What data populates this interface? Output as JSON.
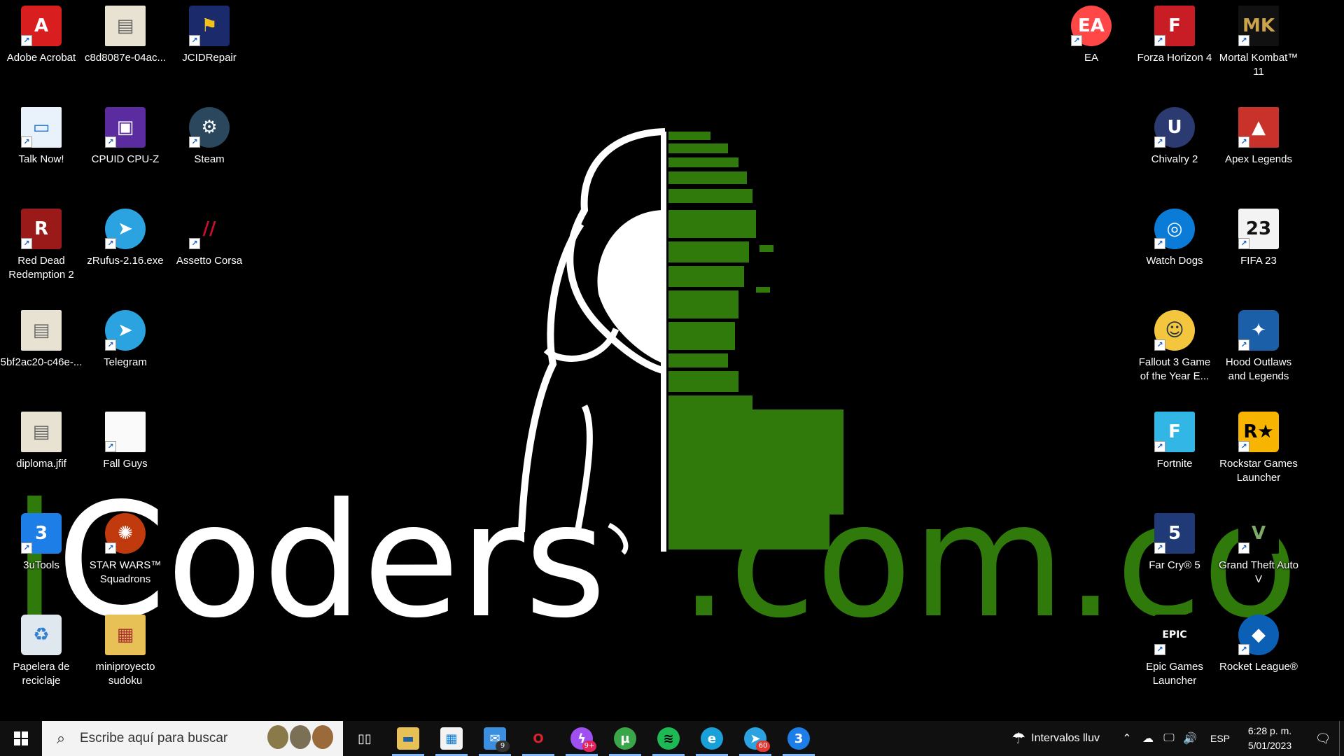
{
  "wallpaper": {
    "brand_lead": "i",
    "brand_rest": "Coders",
    "domain": ".com.co"
  },
  "desktop_icons": [
    {
      "id": "adobe-acrobat",
      "label": "Adobe Acrobat",
      "icon": "acrobat-icon"
    },
    {
      "id": "c8d8087e",
      "label": "c8d8087e-04ac...",
      "icon": "image-file-icon"
    },
    {
      "id": "jcidrepair",
      "label": "JCIDRepair",
      "icon": "jcid-icon"
    },
    {
      "id": "talk-now",
      "label": "Talk Now!",
      "icon": "window-icon"
    },
    {
      "id": "cpuz",
      "label": "CPUID CPU-Z",
      "icon": "cpu-icon"
    },
    {
      "id": "steam",
      "label": "Steam",
      "icon": "steam-icon"
    },
    {
      "id": "rdr2",
      "label": "Red Dead Redemption 2",
      "icon": "rdr2-icon"
    },
    {
      "id": "zrufus",
      "label": "zRufus-2.16.exe",
      "icon": "telegram-icon"
    },
    {
      "id": "assetto",
      "label": "Assetto Corsa",
      "icon": "assetto-icon"
    },
    {
      "id": "5bf2ac20",
      "label": "5bf2ac20-c46e-...",
      "icon": "image-file-icon"
    },
    {
      "id": "telegram",
      "label": "Telegram",
      "icon": "telegram-icon"
    },
    {
      "id": "diploma",
      "label": "diploma.jfif",
      "icon": "image-file-icon"
    },
    {
      "id": "fall-guys",
      "label": "Fall Guys",
      "icon": "blank-file-icon"
    },
    {
      "id": "3utools",
      "label": "3uTools",
      "icon": "3utools-icon"
    },
    {
      "id": "swsquadrons",
      "label": "STAR WARS™ Squadrons",
      "icon": "rebel-icon"
    },
    {
      "id": "recycle",
      "label": "Papelera de reciclaje",
      "icon": "recycle-bin-icon"
    },
    {
      "id": "sudoku",
      "label": "miniproyecto sudoku",
      "icon": "folder-icon"
    },
    {
      "id": "ea",
      "label": "EA",
      "icon": "ea-icon"
    },
    {
      "id": "forza",
      "label": "Forza Horizon 4",
      "icon": "forza-icon"
    },
    {
      "id": "mk11",
      "label": "Mortal Kombat™ 11",
      "icon": "mk-icon"
    },
    {
      "id": "chivalry",
      "label": "Chivalry 2",
      "icon": "unreal-icon"
    },
    {
      "id": "apex",
      "label": "Apex Legends",
      "icon": "apex-icon"
    },
    {
      "id": "watchdogs",
      "label": "Watch Dogs",
      "icon": "ubisoft-icon"
    },
    {
      "id": "fifa",
      "label": "FIFA 23",
      "icon": "fifa-icon"
    },
    {
      "id": "fallout3",
      "label": "Fallout 3 Game of the Year E...",
      "icon": "vault-boy-icon"
    },
    {
      "id": "hood",
      "label": "Hood Outlaws and Legends",
      "icon": "hood-icon"
    },
    {
      "id": "fortnite",
      "label": "Fortnite",
      "icon": "fortnite-icon"
    },
    {
      "id": "rockstar",
      "label": "Rockstar Games Launcher",
      "icon": "rockstar-icon"
    },
    {
      "id": "farcry5",
      "label": "Far Cry® 5",
      "icon": "farcry-icon"
    },
    {
      "id": "gtav",
      "label": "Grand Theft Auto V",
      "icon": "gta-icon"
    },
    {
      "id": "epic",
      "label": "Epic Games Launcher",
      "icon": "epic-icon"
    },
    {
      "id": "rocket",
      "label": "Rocket League®",
      "icon": "rocket-league-icon"
    }
  ],
  "taskbar": {
    "search_placeholder": "Escribe aquí para buscar",
    "apps": [
      {
        "id": "task-view",
        "icon": "task-view-icon",
        "badge": ""
      },
      {
        "id": "file-explorer",
        "icon": "folder-icon",
        "badge": ""
      },
      {
        "id": "ms-store",
        "icon": "store-icon",
        "badge": ""
      },
      {
        "id": "mail",
        "icon": "mail-icon",
        "badge": "9"
      },
      {
        "id": "opera",
        "icon": "opera-icon",
        "badge": ""
      },
      {
        "id": "messenger",
        "icon": "messenger-icon",
        "badge": "9+"
      },
      {
        "id": "utorrent",
        "icon": "utorrent-icon",
        "badge": ""
      },
      {
        "id": "spotify",
        "icon": "spotify-icon",
        "badge": ""
      },
      {
        "id": "edge",
        "icon": "edge-icon",
        "badge": ""
      },
      {
        "id": "telegram",
        "icon": "telegram-icon",
        "badge": "60"
      },
      {
        "id": "3utools",
        "icon": "3utools-icon",
        "badge": ""
      }
    ],
    "weather": "Intervalos lluv",
    "language": "ESP",
    "time": "6:28 p. m.",
    "date": "5/01/2023"
  }
}
